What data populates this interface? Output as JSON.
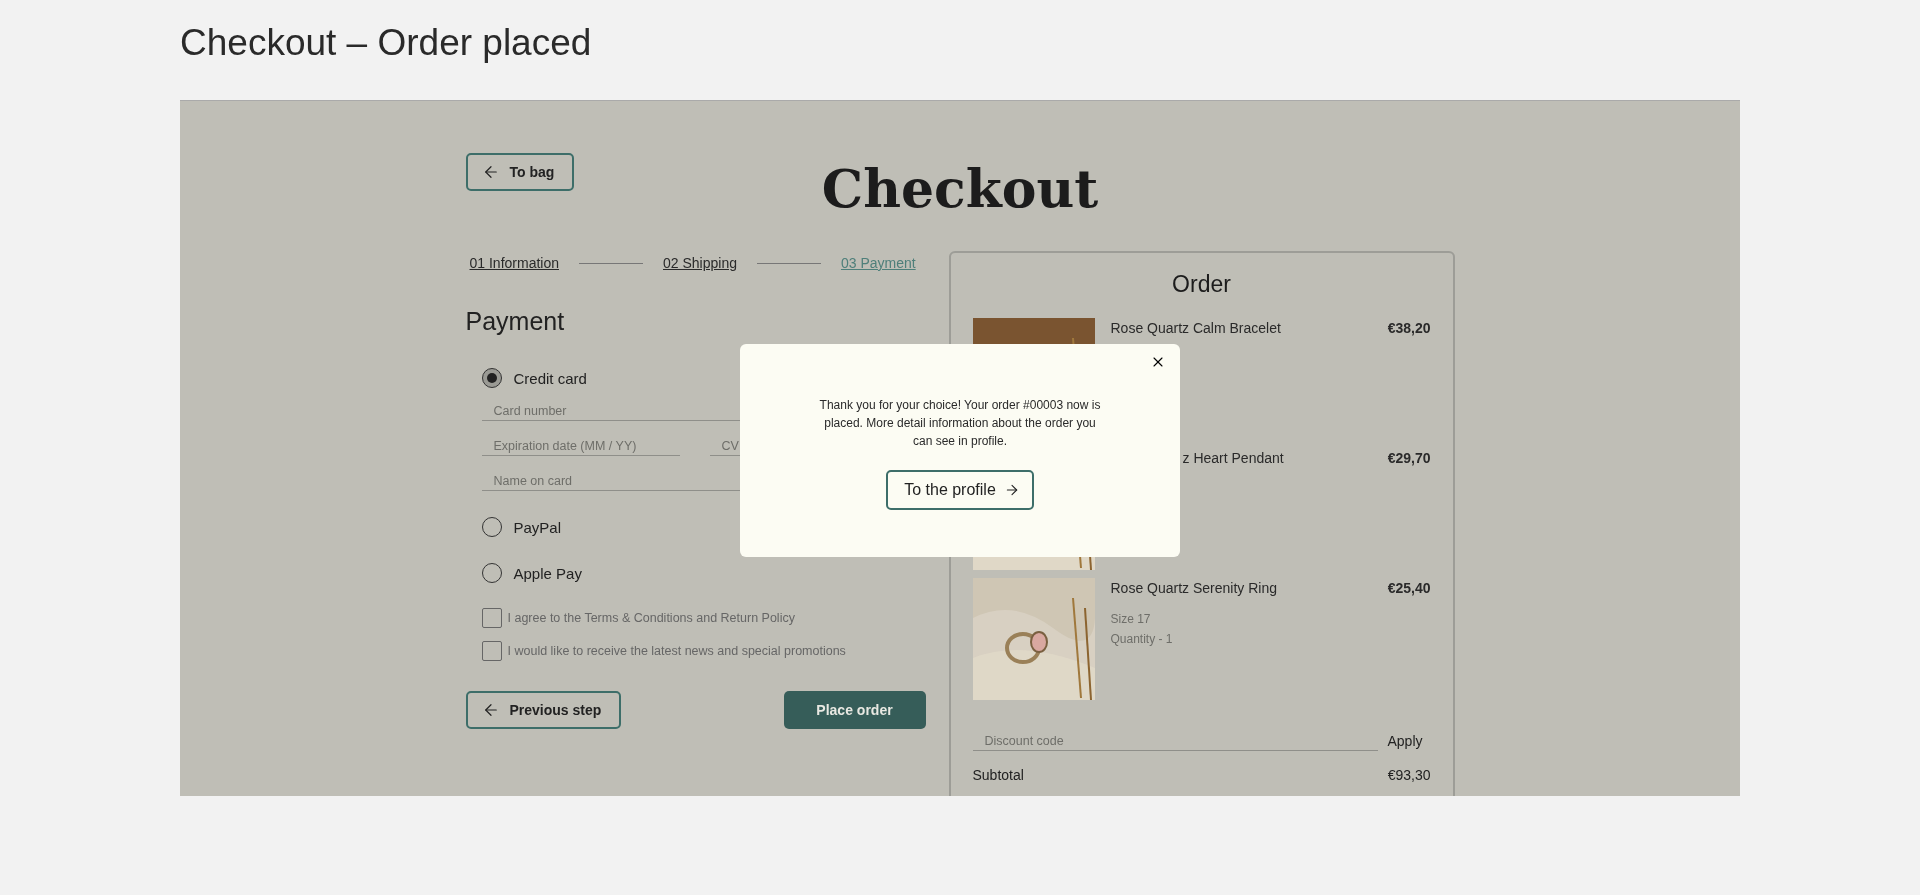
{
  "page_title": "Checkout – Order placed",
  "back_button": {
    "label": "To bag"
  },
  "heading": "Checkout",
  "steps": [
    {
      "label": "01 Information",
      "selected": false
    },
    {
      "label": "02 Shipping",
      "selected": false
    },
    {
      "label": "03 Payment",
      "selected": true
    }
  ],
  "payment": {
    "title": "Payment",
    "methods": [
      {
        "label": "Credit card",
        "selected": true
      },
      {
        "label": "PayPal",
        "selected": false
      },
      {
        "label": "Apple Pay",
        "selected": false
      }
    ],
    "card_fields": {
      "card_number": {
        "placeholder": "Card number"
      },
      "expiration": {
        "placeholder": "Expiration date (MM / YY)"
      },
      "cvv": {
        "placeholder": "CV"
      },
      "name_on_card": {
        "placeholder": "Name on card"
      }
    },
    "agreements": [
      {
        "label": "I agree to the Terms & Conditions and Return Policy",
        "checked": false
      },
      {
        "label": "I would like to receive the latest news and special promotions",
        "checked": false
      }
    ],
    "previous_button": "Previous step",
    "place_order_button": "Place order"
  },
  "order": {
    "title": "Order",
    "items": [
      {
        "kind": "full",
        "name": "Rose Quartz Calm Bracelet",
        "price": "€38,20"
      },
      {
        "kind": "partly_covered",
        "name": "z Heart Pendant",
        "price": "€29,70"
      },
      {
        "kind": "full",
        "name": "Rose Quartz Serenity Ring",
        "price": "€25,40",
        "size": "Size 17",
        "quantity": "Quantity - 1"
      }
    ],
    "discount": {
      "placeholder": "Discount code",
      "button": "Apply"
    },
    "subtotal": {
      "label": "Subtotal",
      "value": "€93,30"
    }
  },
  "modal": {
    "message": "Thank you for your choice! Your order #00003 now is placed. More detail information about the order you can see in profile.",
    "button": "To the profile"
  }
}
